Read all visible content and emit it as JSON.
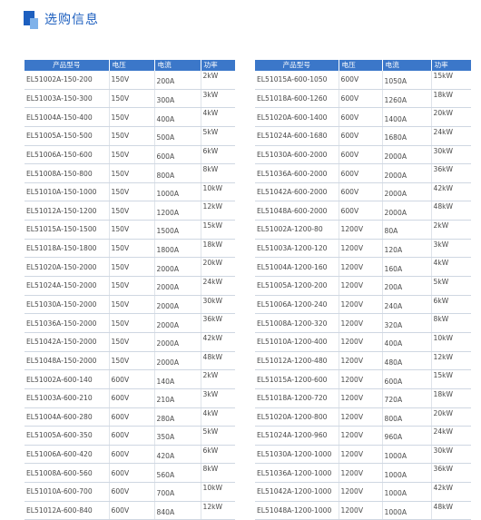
{
  "page": {
    "title": "选购信息",
    "accent_color": "#1d5fbf",
    "header_color": "#3b77c9"
  },
  "tables": [
    {
      "headers": [
        "产品型号",
        "电压",
        "电流",
        "功率"
      ],
      "rows": [
        [
          "EL51002A-150-200",
          "150V",
          "200A",
          "2kW"
        ],
        [
          "EL51003A-150-300",
          "150V",
          "300A",
          "3kW"
        ],
        [
          "EL51004A-150-400",
          "150V",
          "400A",
          "4kW"
        ],
        [
          "EL51005A-150-500",
          "150V",
          "500A",
          "5kW"
        ],
        [
          "EL51006A-150-600",
          "150V",
          "600A",
          "6kW"
        ],
        [
          "EL51008A-150-800",
          "150V",
          "800A",
          "8kW"
        ],
        [
          "EL51010A-150-1000",
          "150V",
          "1000A",
          "10kW"
        ],
        [
          "EL51012A-150-1200",
          "150V",
          "1200A",
          "12kW"
        ],
        [
          "EL51015A-150-1500",
          "150V",
          "1500A",
          "15kW"
        ],
        [
          "EL51018A-150-1800",
          "150V",
          "1800A",
          "18kW"
        ],
        [
          "EL51020A-150-2000",
          "150V",
          "2000A",
          "20kW"
        ],
        [
          "EL51024A-150-2000",
          "150V",
          "2000A",
          "24kW"
        ],
        [
          "EL51030A-150-2000",
          "150V",
          "2000A",
          "30kW"
        ],
        [
          "EL51036A-150-2000",
          "150V",
          "2000A",
          "36kW"
        ],
        [
          "EL51042A-150-2000",
          "150V",
          "2000A",
          "42kW"
        ],
        [
          "EL51048A-150-2000",
          "150V",
          "2000A",
          "48kW"
        ],
        [
          "EL51002A-600-140",
          "600V",
          "140A",
          "2kW"
        ],
        [
          "EL51003A-600-210",
          "600V",
          "210A",
          "3kW"
        ],
        [
          "EL51004A-600-280",
          "600V",
          "280A",
          "4kW"
        ],
        [
          "EL51005A-600-350",
          "600V",
          "350A",
          "5kW"
        ],
        [
          "EL51006A-600-420",
          "600V",
          "420A",
          "6kW"
        ],
        [
          "EL51008A-600-560",
          "600V",
          "560A",
          "8kW"
        ],
        [
          "EL51010A-600-700",
          "600V",
          "700A",
          "10kW"
        ],
        [
          "EL51012A-600-840",
          "600V",
          "840A",
          "12kW"
        ]
      ]
    },
    {
      "headers": [
        "产品型号",
        "电压",
        "电流",
        "功率"
      ],
      "rows": [
        [
          "EL51015A-600-1050",
          "600V",
          "1050A",
          "15kW"
        ],
        [
          "EL51018A-600-1260",
          "600V",
          "1260A",
          "18kW"
        ],
        [
          "EL51020A-600-1400",
          "600V",
          "1400A",
          "20kW"
        ],
        [
          "EL51024A-600-1680",
          "600V",
          "1680A",
          "24kW"
        ],
        [
          "EL51030A-600-2000",
          "600V",
          "2000A",
          "30kW"
        ],
        [
          "EL51036A-600-2000",
          "600V",
          "2000A",
          "36kW"
        ],
        [
          "EL51042A-600-2000",
          "600V",
          "2000A",
          "42kW"
        ],
        [
          "EL51048A-600-2000",
          "600V",
          "2000A",
          "48kW"
        ],
        [
          "EL51002A-1200-80",
          "1200V",
          "80A",
          "2kW"
        ],
        [
          "EL51003A-1200-120",
          "1200V",
          "120A",
          "3kW"
        ],
        [
          "EL51004A-1200-160",
          "1200V",
          "160A",
          "4kW"
        ],
        [
          "EL51005A-1200-200",
          "1200V",
          "200A",
          "5kW"
        ],
        [
          "EL51006A-1200-240",
          "1200V",
          "240A",
          "6kW"
        ],
        [
          "EL51008A-1200-320",
          "1200V",
          "320A",
          "8kW"
        ],
        [
          "EL51010A-1200-400",
          "1200V",
          "400A",
          "10kW"
        ],
        [
          "EL51012A-1200-480",
          "1200V",
          "480A",
          "12kW"
        ],
        [
          "EL51015A-1200-600",
          "1200V",
          "600A",
          "15kW"
        ],
        [
          "EL51018A-1200-720",
          "1200V",
          "720A",
          "18kW"
        ],
        [
          "EL51020A-1200-800",
          "1200V",
          "800A",
          "20kW"
        ],
        [
          "EL51024A-1200-960",
          "1200V",
          "960A",
          "24kW"
        ],
        [
          "EL51030A-1200-1000",
          "1200V",
          "1000A",
          "30kW"
        ],
        [
          "EL51036A-1200-1000",
          "1200V",
          "1000A",
          "36kW"
        ],
        [
          "EL51042A-1200-1000",
          "1200V",
          "1000A",
          "42kW"
        ],
        [
          "EL51048A-1200-1000",
          "1200V",
          "1000A",
          "48kW"
        ]
      ]
    }
  ]
}
